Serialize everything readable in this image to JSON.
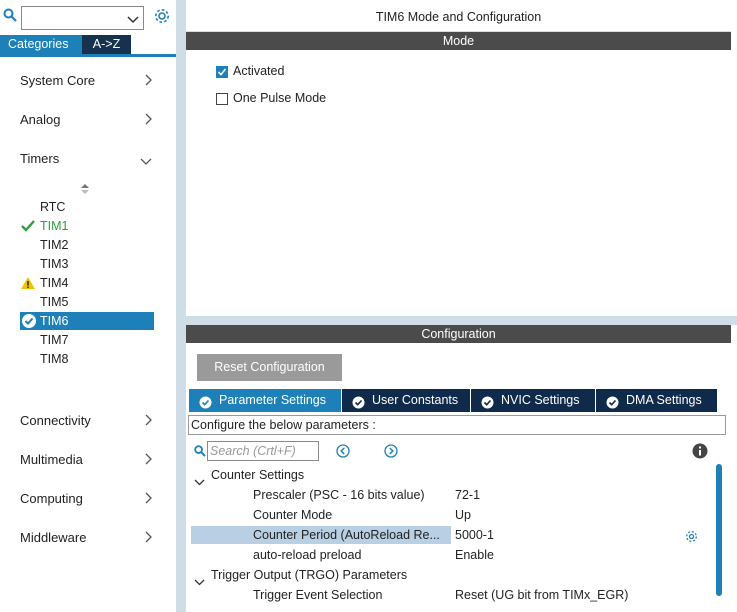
{
  "sidebar": {
    "search_value": "",
    "tabs": [
      {
        "label": "Categories",
        "active": true
      },
      {
        "label": "A->Z",
        "active": false
      }
    ],
    "categories_top": [
      {
        "label": "System Core",
        "expanded": false
      },
      {
        "label": "Analog",
        "expanded": false
      },
      {
        "label": "Timers",
        "expanded": true
      }
    ],
    "timers": [
      {
        "label": "RTC",
        "status": "none"
      },
      {
        "label": "TIM1",
        "status": "ok"
      },
      {
        "label": "TIM2",
        "status": "none"
      },
      {
        "label": "TIM3",
        "status": "none"
      },
      {
        "label": "TIM4",
        "status": "warning"
      },
      {
        "label": "TIM5",
        "status": "none"
      },
      {
        "label": "TIM6",
        "status": "selected-ok"
      },
      {
        "label": "TIM7",
        "status": "none"
      },
      {
        "label": "TIM8",
        "status": "none"
      }
    ],
    "categories_bottom": [
      {
        "label": "Connectivity"
      },
      {
        "label": "Multimedia"
      },
      {
        "label": "Computing"
      },
      {
        "label": "Middleware"
      }
    ]
  },
  "main": {
    "title": "TIM6 Mode and Configuration",
    "mode_header": "Mode",
    "mode_options": [
      {
        "label": "Activated",
        "checked": true
      },
      {
        "label": "One Pulse Mode",
        "checked": false
      }
    ],
    "config_header": "Configuration",
    "reset_button": "Reset Configuration",
    "tabs": [
      {
        "label": "Parameter Settings",
        "active": true
      },
      {
        "label": "User Constants",
        "active": false
      },
      {
        "label": "NVIC Settings",
        "active": false
      },
      {
        "label": "DMA Settings",
        "active": false
      }
    ],
    "configure_text": "Configure the below parameters :",
    "search_placeholder": "Search (Crtl+F)",
    "groups": [
      {
        "label": "Counter Settings"
      },
      {
        "label": "Trigger Output (TRGO) Parameters"
      }
    ],
    "params": [
      {
        "name": "Prescaler (PSC - 16 bits value)",
        "value": "72-1"
      },
      {
        "name": "Counter Mode",
        "value": "Up"
      },
      {
        "name": "Counter Period (AutoReload Re...",
        "value": "5000-1"
      },
      {
        "name": "auto-reload preload",
        "value": "Enable"
      },
      {
        "name": "Trigger Event Selection",
        "value": "Reset (UG bit from TIMx_EGR)"
      }
    ]
  },
  "colors": {
    "accent": "#1e80b8",
    "dark_tab": "#0f2a4a",
    "header_bar": "#4b4b4b",
    "ok_green": "#2e9e3c",
    "warning_yellow": "#f2c200"
  }
}
